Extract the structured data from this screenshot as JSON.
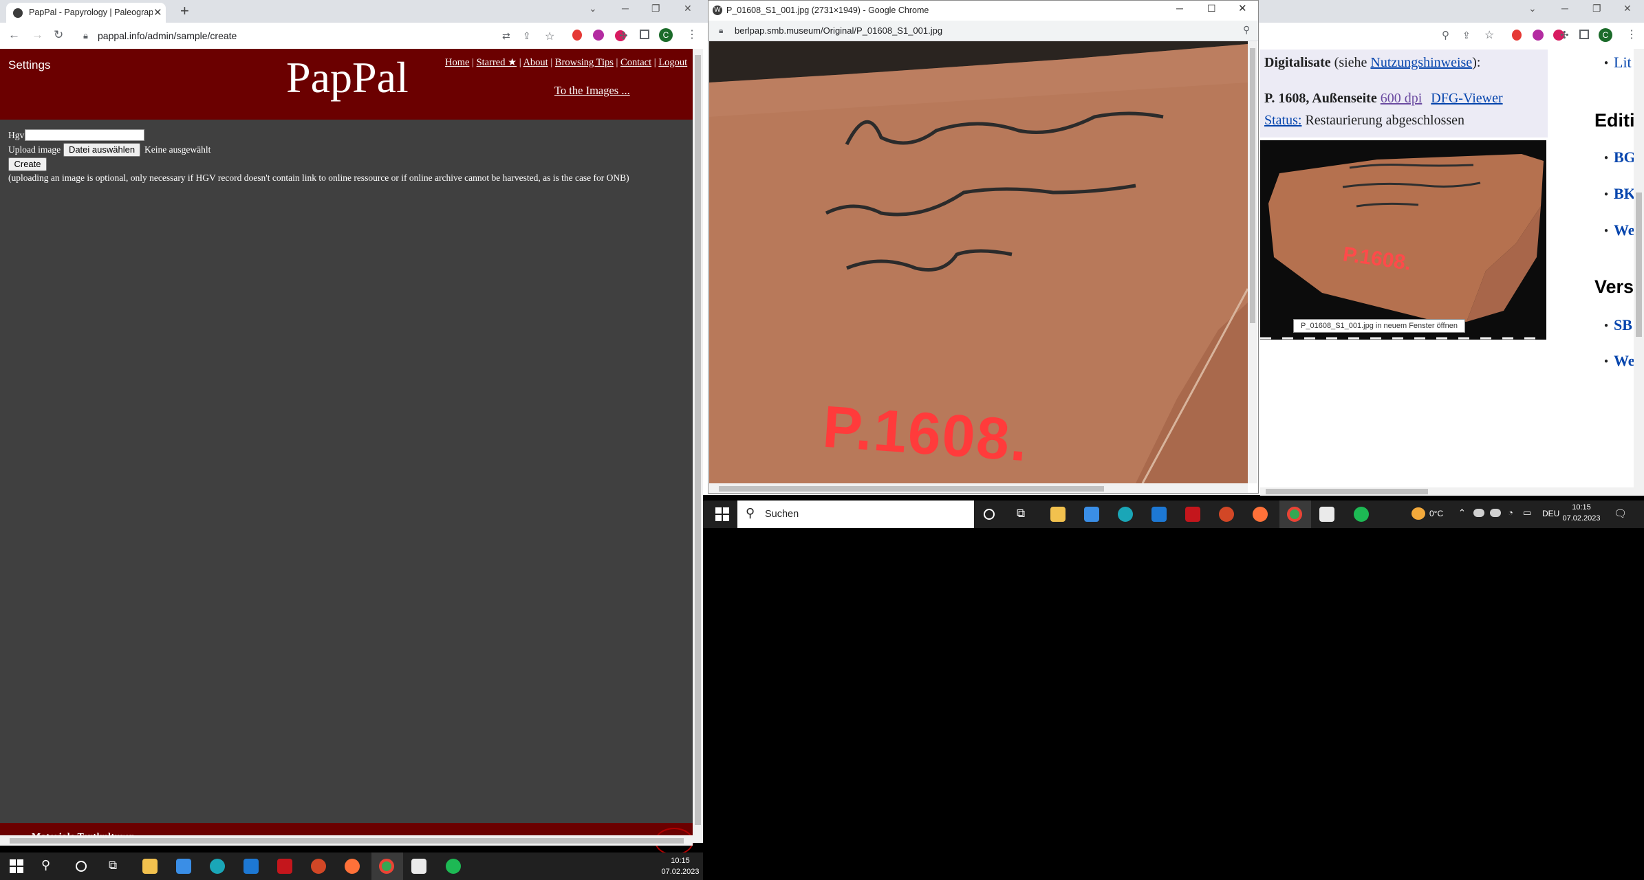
{
  "left_browser": {
    "tab_title": "PapPal - Papyrology | Paleography",
    "url": "pappal.info/admin/sample/create"
  },
  "pappal": {
    "settings": "Settings",
    "logo": "PapPal",
    "nav": [
      "Home",
      "Starred ★",
      "About",
      "Browsing Tips",
      "Contact",
      "Logout"
    ],
    "to_images": "To the Images ...",
    "form": {
      "hgv_label": "Hgv",
      "upload_label": "Upload image",
      "file_button": "Datei auswählen",
      "file_status": "Keine ausgewählt",
      "create_button": "Create",
      "note": "(uploading an image is optional, only necessary if HGV record doesn't contain link to online ressource or if online archive cannot be harvested, as is the case for ONB)"
    },
    "footer": "Materiale Textkulturen"
  },
  "left_taskbar": {
    "time": "10:15",
    "date": "07.02.2023"
  },
  "popup": {
    "title": "P_01608_S1_001.jpg (2731×1949) - Google Chrome",
    "url": "berlpap.smb.museum/Original/P_01608_S1_001.jpg",
    "image_caption": "P.1608."
  },
  "right_page": {
    "digitalisate_label": "Digitalisate",
    "siehe": "(siehe",
    "nutzungshinweise": "Nutzungshinweise",
    "close_paren": "):",
    "record_title": "P. 1608, Außenseite",
    "dpi_link": "600 dpi",
    "dfg_link": "DFG-Viewer",
    "status_label": "Status:",
    "status_value": "Restaurierung abgeschlossen",
    "thumb_tooltip": "P_01608_S1_001.jpg in neuem Fenster öffnen",
    "thumb_caption": "P.1608.",
    "sidebar": {
      "lit": "Lit",
      "editionen": "Editi",
      "items1": [
        "BG",
        "BK",
        "We"
      ],
      "versionen": "Vers",
      "items2": [
        "SB",
        "We"
      ]
    }
  },
  "right_taskbar": {
    "search": "Suchen",
    "weather": "0°C",
    "lang": "DEU",
    "time": "10:15",
    "date": "07.02.2023"
  }
}
